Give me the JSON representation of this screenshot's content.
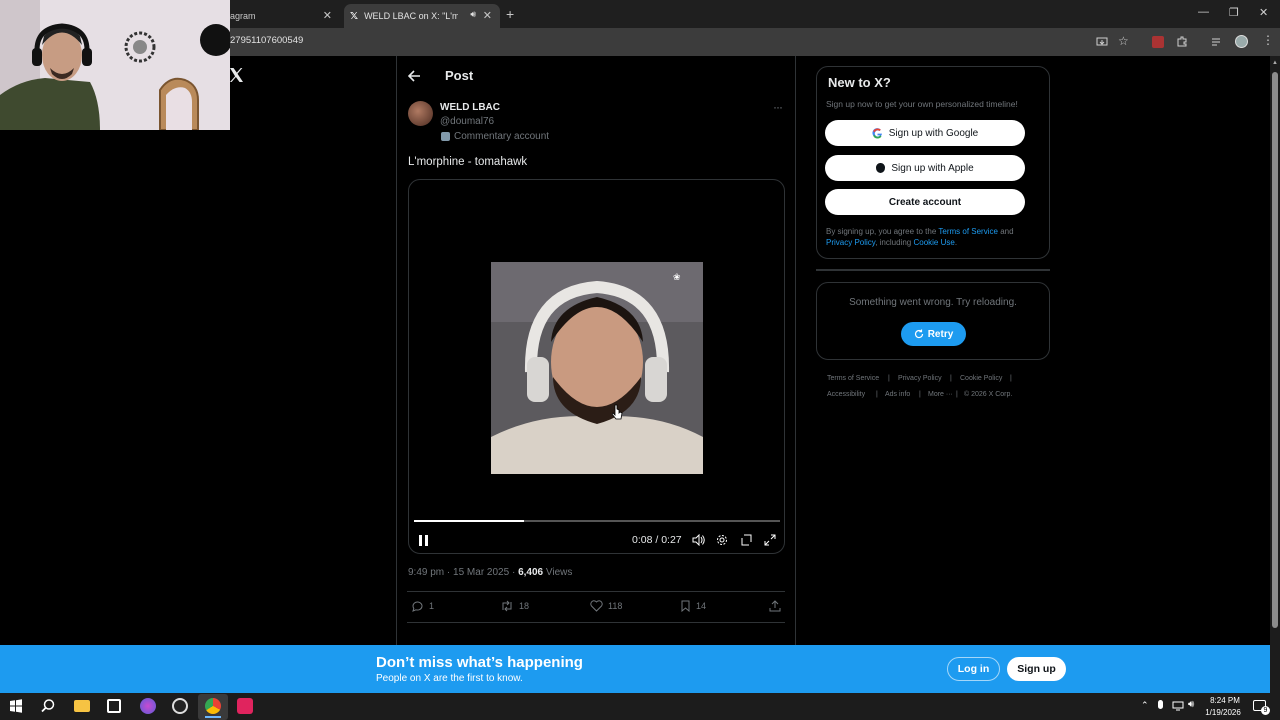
{
  "browser": {
    "tabs": [
      {
        "title": "agram"
      },
      {
        "title": "WELD LBAC on X: \"L'morph"
      }
    ],
    "url": "27951107600549"
  },
  "page": {
    "header_title": "Post",
    "author": {
      "name": "WELD LBAC",
      "handle": "@doumal76",
      "label": "Commentary account"
    },
    "post_text": "L'morphine - tomahawk",
    "video": {
      "current_time": "0:08",
      "duration": "0:27",
      "time_display": "0:08 / 0:27",
      "progress": 0.3
    },
    "meta": {
      "time": "9:49 pm",
      "date": "15 Mar 2025",
      "views_count": "6,406",
      "views_label": "Views"
    },
    "actions": {
      "replies": "1",
      "reposts": "18",
      "likes": "118",
      "bookmarks": "14"
    }
  },
  "sidebar": {
    "signup_title": "New to X?",
    "signup_sub": "Sign up now to get your own personalized timeline!",
    "google_label": "Sign up with Google",
    "apple_label": "Sign up with Apple",
    "create_label": "Create account",
    "terms_prefix": "By signing up, you agree to the",
    "terms_link": "Terms of Service",
    "terms_and": "and",
    "privacy_link": "Privacy Policy",
    "terms_including": ", including",
    "cookie_link": "Cookie Use",
    "error_text": "Something went wrong. Try reloading.",
    "retry_label": "Retry",
    "footer": {
      "terms": "Terms of Service",
      "privacy": "Privacy Policy",
      "cookie": "Cookie Policy",
      "accessibility": "Accessibility",
      "ads": "Ads info",
      "more": "More ···",
      "copyright": "© 2026 X Corp."
    }
  },
  "banner": {
    "title": "Don’t miss what’s happening",
    "subtitle": "People on X are the first to know.",
    "login_label": "Log in",
    "signup_label": "Sign up"
  },
  "taskbar": {
    "time": "8:24 PM",
    "date": "1/19/2026",
    "notification_count": "9"
  },
  "colors": {
    "accent": "#1d9bf0",
    "background": "#000000",
    "border": "#2f3336",
    "muted_text": "#71767b"
  }
}
